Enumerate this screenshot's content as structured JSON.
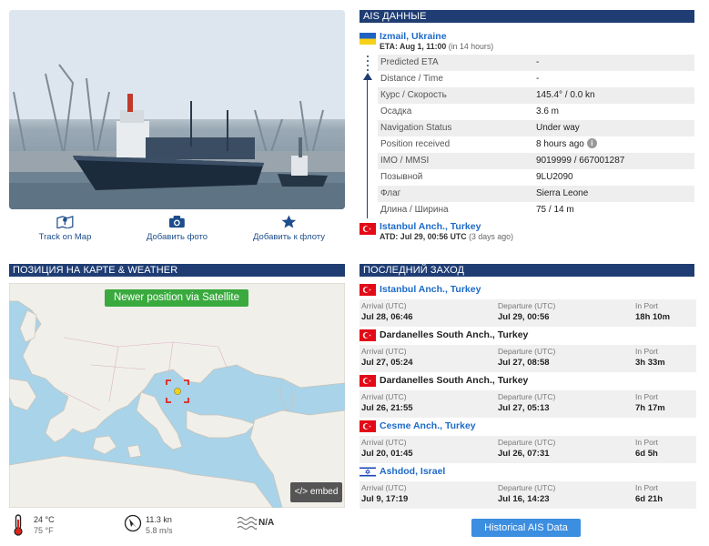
{
  "actions": [
    {
      "label": "Track on Map",
      "icon": "map-pin-icon"
    },
    {
      "label": "Добавить фото",
      "icon": "camera-icon"
    },
    {
      "label": "Добавить к флоту",
      "icon": "star-icon"
    }
  ],
  "ais": {
    "header": "AIS ДАННЫЕ",
    "destination": {
      "flag": "ukraine-flag",
      "name": "Izmail, Ukraine",
      "eta_label": "ETA: Aug 1, 11:00",
      "eta_rel": "(in 14 hours)"
    },
    "rows": [
      {
        "key": "Predicted ETA",
        "value": "-"
      },
      {
        "key": "Distance / Time",
        "value": "-"
      },
      {
        "key": "Курс / Скорость",
        "value": "145.4° / 0.0 kn"
      },
      {
        "key": "Осадка",
        "value": "3.6 m"
      },
      {
        "key": "Navigation Status",
        "value": "Under way"
      },
      {
        "key": "Position received",
        "value": "8 hours ago"
      },
      {
        "key": "IMO / MMSI",
        "value": "9019999 / 667001287"
      },
      {
        "key": "Позывной",
        "value": "9LU2090"
      },
      {
        "key": "Флаг",
        "value": "Sierra Leone"
      },
      {
        "key": "Длина / Ширина",
        "value": "75 / 14 m"
      }
    ],
    "origin": {
      "flag": "turkey-flag",
      "name": "Istanbul Anch., Turkey",
      "atd_label": "ATD: Jul 29, 00:56 UTC",
      "atd_rel": "(3 days ago)"
    }
  },
  "map_section": {
    "header": "ПОЗИЦИЯ НА КАРТЕ & WEATHER",
    "satellite_button": "Newer position via Satellite",
    "embed_button": "</> embed"
  },
  "weather": {
    "temp_c": "24 °C",
    "temp_f": "75 °F",
    "wind_kn": "11.3 kn",
    "wind_ms": "5.8 m/s",
    "waves": "N/A"
  },
  "port_calls": {
    "header": "ПОСЛЕДНИЙ ЗАХОД",
    "labels": {
      "arrival": "Arrival (UTC)",
      "departure": "Departure (UTC)",
      "in_port": "In Port"
    },
    "calls": [
      {
        "flag": "turkey-flag",
        "name": "Istanbul Anch., Turkey",
        "link": true,
        "arrival": "Jul 28, 06:46",
        "departure": "Jul 29, 00:56",
        "in_port": "18h 10m"
      },
      {
        "flag": "turkey-flag",
        "name": "Dardanelles South Anch., Turkey",
        "link": false,
        "arrival": "Jul 27, 05:24",
        "departure": "Jul 27, 08:58",
        "in_port": "3h 33m"
      },
      {
        "flag": "turkey-flag",
        "name": "Dardanelles South Anch., Turkey",
        "link": false,
        "arrival": "Jul 26, 21:55",
        "departure": "Jul 27, 05:13",
        "in_port": "7h 17m"
      },
      {
        "flag": "turkey-flag",
        "name": "Cesme Anch., Turkey",
        "link": true,
        "arrival": "Jul 20, 01:45",
        "departure": "Jul 26, 07:31",
        "in_port": "6d 5h"
      },
      {
        "flag": "israel-flag",
        "name": "Ashdod, Israel",
        "link": true,
        "arrival": "Jul 9, 17:19",
        "departure": "Jul 16, 14:23",
        "in_port": "6d 21h"
      }
    ],
    "history_button": "Historical AIS Data"
  },
  "colors": {
    "header_bg": "#1f3d73",
    "link": "#1d6ac8",
    "green_button": "#3aaa3e",
    "blue_button": "#3b8ee0"
  }
}
